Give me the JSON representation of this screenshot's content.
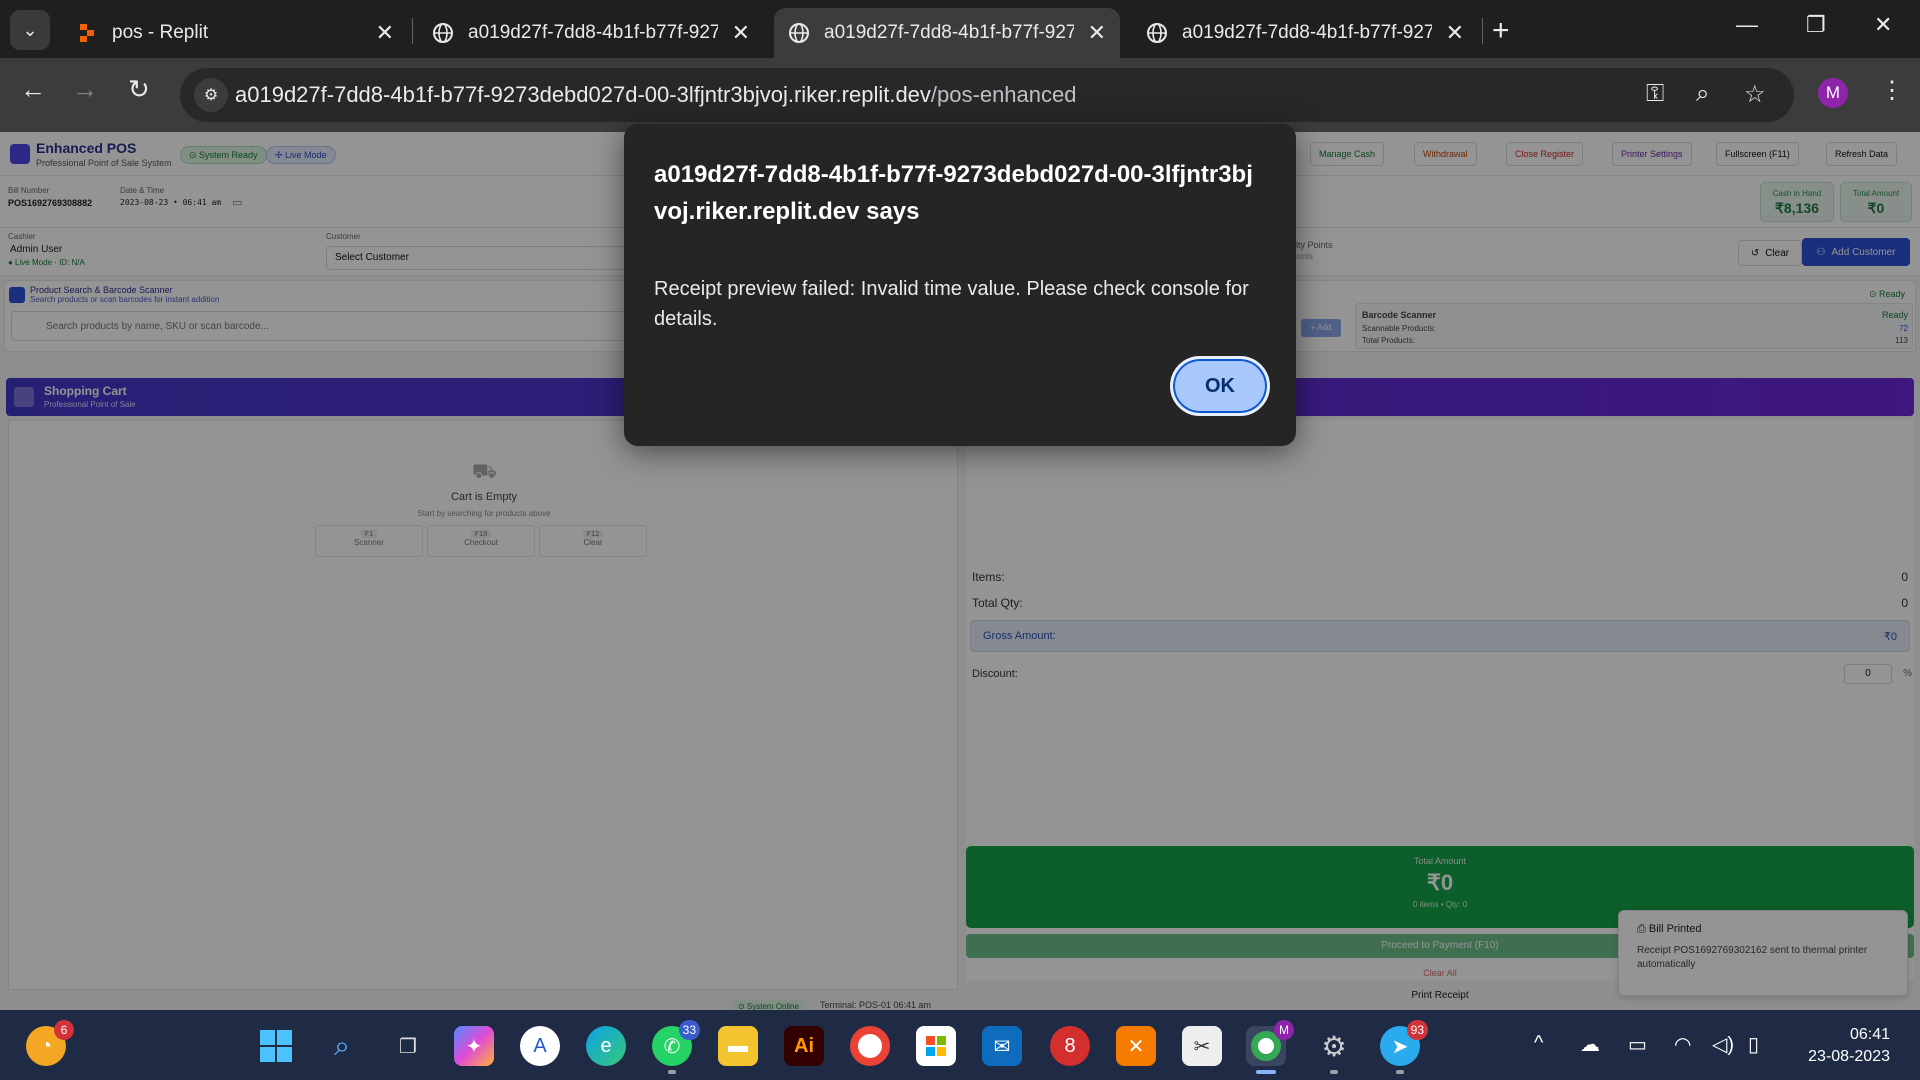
{
  "browser": {
    "tabs": [
      {
        "label": "pos - Replit",
        "icon": "replit-icon",
        "active": false
      },
      {
        "label": "a019d27f-7dd8-4b1f-b77f-9273",
        "icon": "globe-icon",
        "active": false
      },
      {
        "label": "a019d27f-7dd8-4b1f-b77f-9273",
        "icon": "globe-icon",
        "active": true
      },
      {
        "label": "a019d27f-7dd8-4b1f-b77f-9273",
        "icon": "globe-icon",
        "active": false
      }
    ],
    "url_host": "a019d27f-7dd8-4b1f-b77f-9273debd027d-00-3lfjntr3bjvoj.riker.replit.dev",
    "url_path": "/pos-enhanced",
    "profile_initial": "M"
  },
  "pos": {
    "title": "Enhanced POS",
    "subtitle": "Professional Point of Sale System",
    "status_ready": "⊙ System Ready",
    "status_live": "✢ Live Mode",
    "header_buttons": {
      "manage_cash": "Manage Cash",
      "withdrawal": "Withdrawal",
      "close_register": "Close Register",
      "printer_settings": "Printer Settings",
      "fullscreen": "Fullscreen (F11)",
      "refresh": "Refresh Data"
    },
    "bill_number_label": "Bill Number",
    "bill_number": "POS1692769308882",
    "datetime_label": "Date & Time",
    "datetime": "2023-08-23 • 06:41 am",
    "cash_in_hand_label": "Cash in Hand",
    "cash_in_hand": "₹8,136",
    "total_amount_label": "Total Amount",
    "total_amount": "₹0",
    "cashier_label": "Cashier",
    "cashier_name": "Admin User",
    "cashier_meta": "● Live Mode · ID: N/A",
    "customer_label": "Customer",
    "customer_select": "Select Customer",
    "loyalty_label": "lty Points",
    "loyalty_sub": "oints",
    "clear_label": "Clear",
    "add_customer_label": "Add Customer",
    "search_title": "Product Search & Barcode Scanner",
    "search_sub": "Search products or scan barcodes for instant addition",
    "search_placeholder": "Search products by name, SKU or scan barcode...",
    "ready_label": "⊙ Ready",
    "add_label": "+ Add",
    "scanner": {
      "title": "Barcode Scanner",
      "status": "Ready",
      "scannable_label": "Scannable Products:",
      "scannable_value": "72",
      "total_label": "Total Products:",
      "total_value": "113"
    },
    "cart_title": "Shopping Cart",
    "cart_sub": "Professional Point of Sale",
    "cart_empty_title": "Cart is Empty",
    "cart_empty_sub": "Start by searching for products above",
    "shortcuts": [
      {
        "key": "F1",
        "label": "Scanner"
      },
      {
        "key": "F10",
        "label": "Checkout"
      },
      {
        "key": "F12",
        "label": "Clear"
      }
    ],
    "footer_status": "⊙ System Online",
    "footer_terminal": "Terminal: POS-01  06:41 am",
    "summary": {
      "items_label": "Items:",
      "items_value": "0",
      "qty_label": "Total Qty:",
      "qty_value": "0",
      "gross_label": "Gross Amount:",
      "gross_value": "₹0",
      "discount_label": "Discount:",
      "discount_value": "0",
      "discount_unit": "%"
    },
    "total_card_label": "Total Amount",
    "total_card_value": "₹0",
    "total_card_sub": "0 items • Qty: 0",
    "proceed_label": "Proceed to Payment (F10)",
    "clear_all_label": "Clear All",
    "print_receipt_label": "Print Receipt"
  },
  "toast": {
    "title": "Bill Printed",
    "message": "Receipt POS1692769302162 sent to thermal printer automatically"
  },
  "dialog": {
    "title": "a019d27f-7dd8-4b1f-b77f-9273debd027d-00-3lfjntr3bjvoj.riker.replit.dev says",
    "message": "Receipt preview failed: Invalid time value. Please check console for details.",
    "ok_label": "OK"
  },
  "taskbar": {
    "widgets_badge": "6",
    "whatsapp_badge": "33",
    "telegram_badge": "93",
    "time": "06:41",
    "date": "23-08-2023"
  }
}
